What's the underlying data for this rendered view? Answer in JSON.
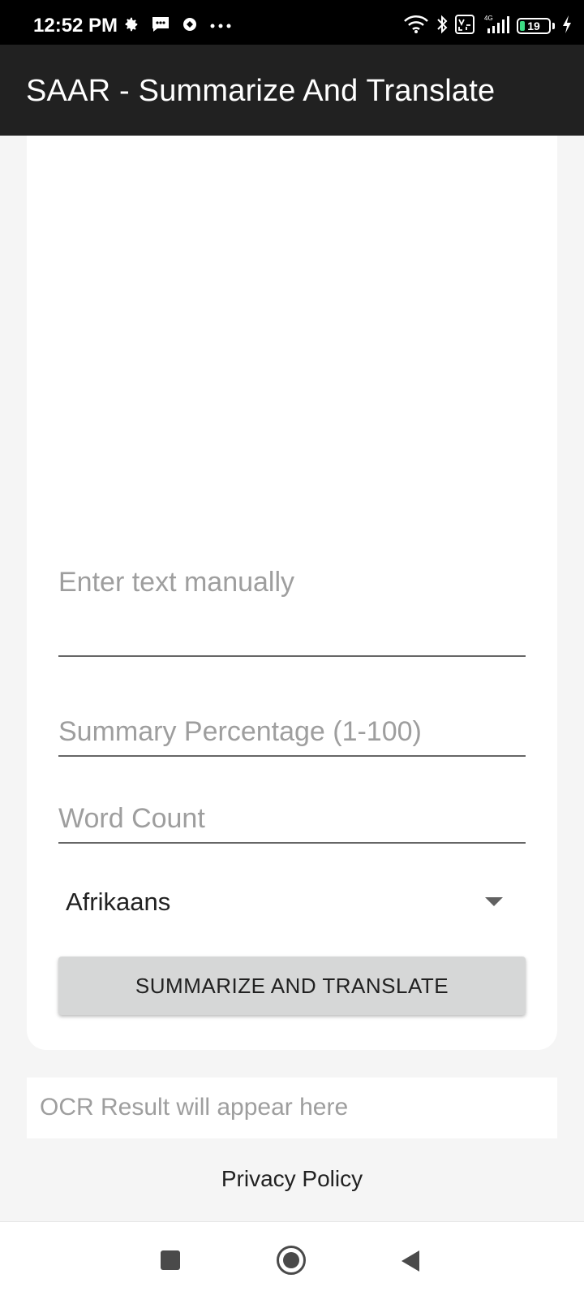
{
  "status_bar": {
    "time": "12:52 PM",
    "battery": "19",
    "left_icons": [
      "settings-icon",
      "message-icon",
      "app-icon",
      "more-icon"
    ],
    "right_icons": [
      "wifi-icon",
      "bluetooth-icon",
      "volte-icon",
      "signal-icon",
      "battery-icon",
      "charging-icon"
    ]
  },
  "app_bar": {
    "title": "SAAR - Summarize And Translate"
  },
  "form": {
    "manual_text_placeholder": "Enter text manually",
    "summary_percentage_placeholder": "Summary Percentage (1-100)",
    "word_count_placeholder": "Word Count",
    "language_selected": "Afrikaans",
    "submit_label": "SUMMARIZE AND TRANSLATE"
  },
  "ocr_result": {
    "placeholder": "OCR Result will appear here"
  },
  "footer": {
    "privacy_link": "Privacy Policy"
  },
  "nav_bar": {
    "buttons": [
      "recents-icon",
      "home-icon",
      "back-icon"
    ]
  },
  "colors": {
    "app_bar": "#212121",
    "button": "#d6d7d7",
    "background": "#f5f5f5",
    "placeholder": "#9e9e9e"
  }
}
